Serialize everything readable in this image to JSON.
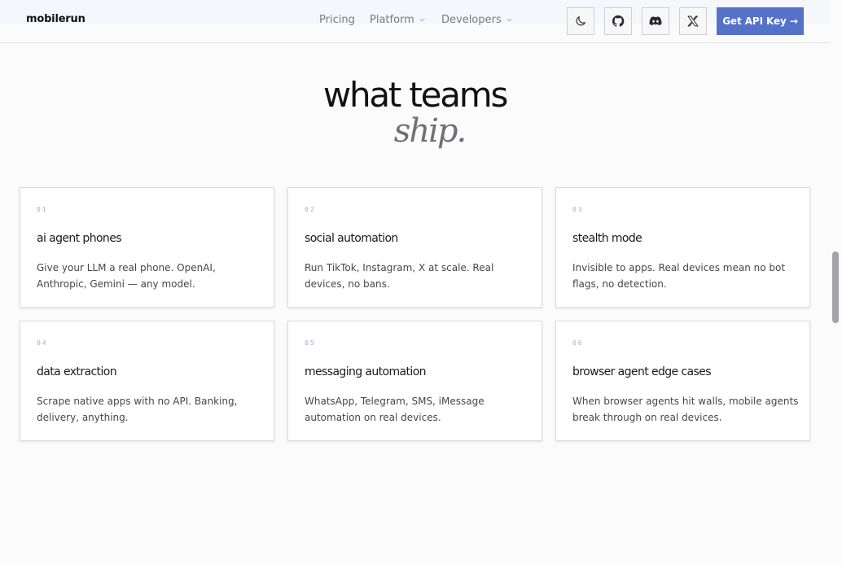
{
  "header": {
    "logo": "mobilerun",
    "nav": {
      "pricing": "Pricing",
      "platform": "Platform",
      "developers": "Developers"
    },
    "icons": [
      "moon-icon",
      "github-icon",
      "discord-icon",
      "x-icon"
    ],
    "cta_label": "Get API Key →",
    "cta_color": "#5472c8"
  },
  "headline": {
    "line1": "what teams",
    "line2": "ship."
  },
  "cards": [
    {
      "num": "01",
      "title": "ai agent phones",
      "desc": "Give your LLM a real phone. OpenAI, Anthropic, Gemini — any model."
    },
    {
      "num": "02",
      "title": "social automation",
      "desc": "Run TikTok, Instagram, X at scale. Real devices, no bans."
    },
    {
      "num": "03",
      "title": "stealth mode",
      "desc": "Invisible to apps. Real devices mean no bot flags, no detection."
    },
    {
      "num": "04",
      "title": "data extraction",
      "desc": "Scrape native apps with no API. Banking, delivery, anything."
    },
    {
      "num": "05",
      "title": "messaging automation",
      "desc": "WhatsApp, Telegram, SMS, iMessage automation on real devices."
    },
    {
      "num": "06",
      "title": "browser agent edge cases",
      "desc": "When browser agents hit walls, mobile agents break through on real devices."
    }
  ]
}
